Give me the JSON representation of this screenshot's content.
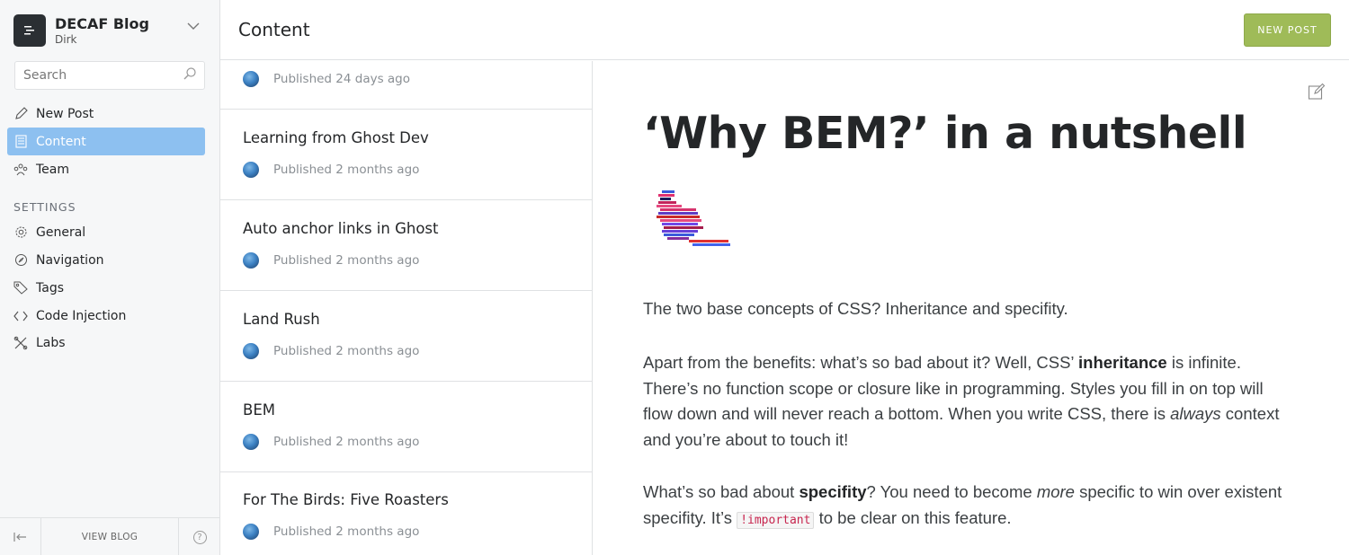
{
  "sidebar": {
    "brand": {
      "title": "DECAF Blog",
      "user": "Dirk"
    },
    "search": {
      "placeholder": "Search"
    },
    "nav": [
      {
        "label": "New Post",
        "icon": "pencil-icon"
      },
      {
        "label": "Content",
        "icon": "content-icon",
        "active": true
      },
      {
        "label": "Team",
        "icon": "team-icon"
      }
    ],
    "settings_header": "SETTINGS",
    "settings": [
      {
        "label": "General",
        "icon": "gear-icon"
      },
      {
        "label": "Navigation",
        "icon": "compass-icon"
      },
      {
        "label": "Tags",
        "icon": "tag-icon"
      },
      {
        "label": "Code Injection",
        "icon": "code-icon"
      },
      {
        "label": "Labs",
        "icon": "labs-icon"
      }
    ],
    "footer": {
      "view_blog": "VIEW BLOG",
      "help": "?"
    }
  },
  "header": {
    "title": "Content",
    "new_post": "NEW POST"
  },
  "posts": [
    {
      "title": "",
      "status": "Published 24 days ago"
    },
    {
      "title": "Learning from Ghost Dev",
      "status": "Published 2 months ago"
    },
    {
      "title": "Auto anchor links in Ghost",
      "status": "Published 2 months ago"
    },
    {
      "title": "Land Rush",
      "status": "Published 2 months ago"
    },
    {
      "title": "BEM",
      "status": "Published 2 months ago"
    },
    {
      "title": "For The Birds: Five Roasters",
      "status": "Published 2 months ago"
    }
  ],
  "preview": {
    "title": "‘Why BEM?’ in a nutshell",
    "p1": "The two base concepts of CSS? Inheritance and specifity.",
    "p2_a": "Apart from the benefits: what’s so bad about it? Well, CSS’ ",
    "p2_b": "inheritance",
    "p2_c": " is infinite. There’s no function scope or closure like in programming. Styles you fill in on top will flow down and will never reach a bottom. When you write CSS, there is ",
    "p2_d": "always",
    "p2_e": " context and you’re about to touch it!",
    "p3_a": "What’s so bad about ",
    "p3_b": "specifity",
    "p3_c": "? You need to become ",
    "p3_d": "more",
    "p3_e": " specific to win over exis­tent specifity. It’s ",
    "p3_code": "!important",
    "p3_f": " to be clear on this feature."
  },
  "colors": {
    "accent_blue": "#8dc0f0",
    "new_post_green": "#9fbb58",
    "code_red": "#c7254e"
  }
}
